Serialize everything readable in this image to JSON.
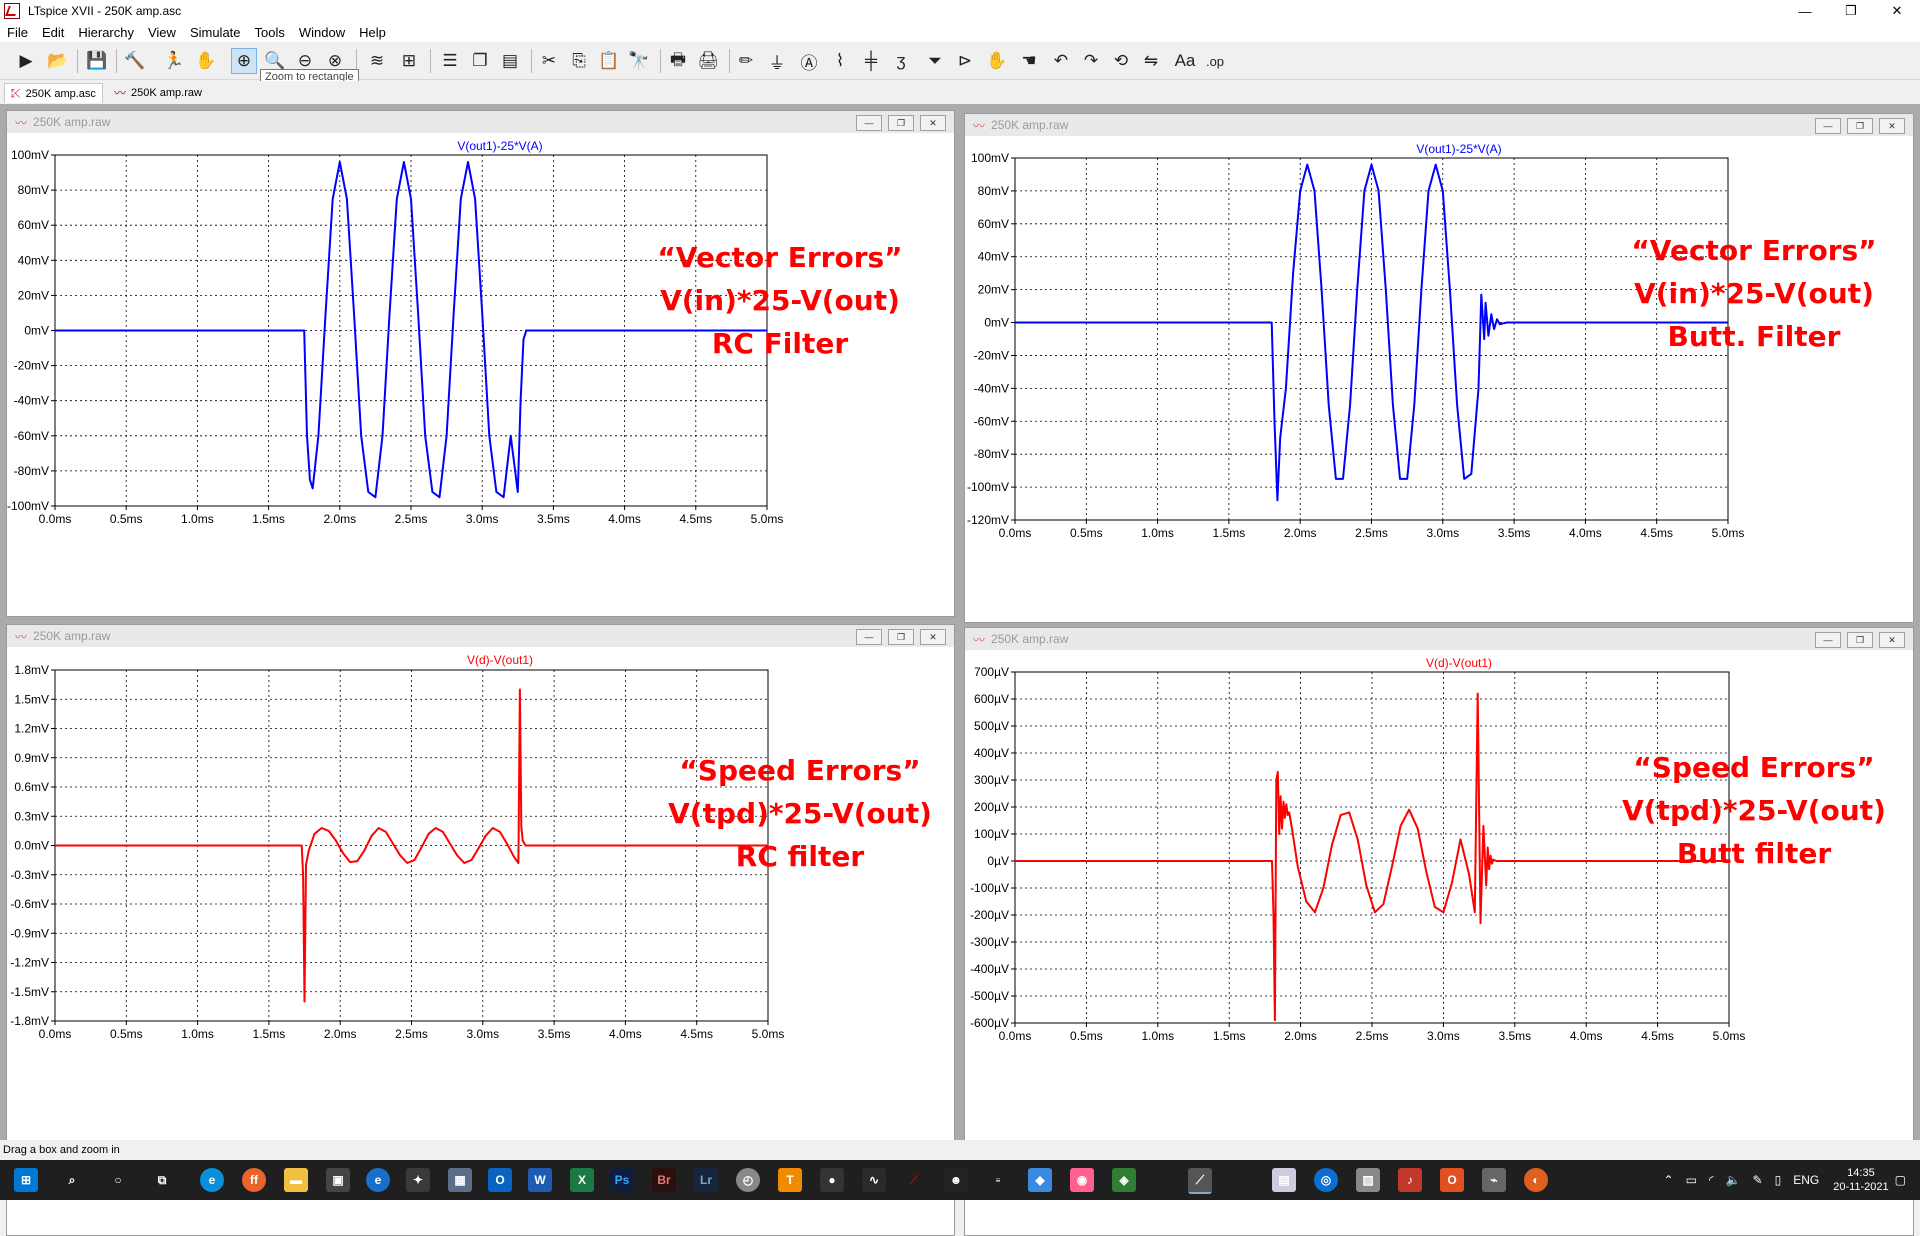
{
  "window": {
    "title": "LTspice XVII - 250K amp.asc",
    "minimize": "—",
    "maximize": "❐",
    "close": "✕"
  },
  "menu": [
    "File",
    "Edit",
    "Hierarchy",
    "View",
    "Simulate",
    "Tools",
    "Window",
    "Help"
  ],
  "tooltip": "Zoom to rectangle",
  "doc_tabs": [
    {
      "label": "250K amp.asc"
    },
    {
      "label": "250K amp.raw"
    }
  ],
  "status": "Drag a box and zoom in",
  "panes": [
    {
      "window_title": "250K amp.raw",
      "trace": "V(out1)-25*V(A)",
      "color": "#0000ff",
      "annotation": [
        "“Vector Errors”",
        "V(in)*25-V(out)",
        "RC Filter"
      ]
    },
    {
      "window_title": "250K amp.raw",
      "trace": "V(out1)-25*V(A)",
      "color": "#0000ff",
      "annotation": [
        "“Vector Errors”",
        "V(in)*25-V(out)",
        "Butt. Filter"
      ]
    },
    {
      "window_title": "250K amp.raw",
      "trace": "V(d)-V(out1)",
      "color": "#ff0000",
      "annotation": [
        "“Speed Errors”",
        "V(tpd)*25-V(out)",
        "RC filter"
      ]
    },
    {
      "window_title": "250K amp.raw",
      "trace": "V(d)-V(out1)",
      "color": "#ff0000",
      "annotation": [
        "“Speed Errors”",
        "V(tpd)*25-V(out)",
        "Butt filter"
      ]
    }
  ],
  "chart_data": [
    {
      "type": "line",
      "title": "V(out1)-25*V(A)",
      "xlim": [
        0,
        5
      ],
      "ylim": [
        -100,
        100
      ],
      "x_ticks": [
        "0.0ms",
        "0.5ms",
        "1.0ms",
        "1.5ms",
        "2.0ms",
        "2.5ms",
        "3.0ms",
        "3.5ms",
        "4.0ms",
        "4.5ms",
        "5.0ms"
      ],
      "y_ticks": [
        "100mV",
        "80mV",
        "60mV",
        "40mV",
        "20mV",
        "0mV",
        "-20mV",
        "-40mV",
        "-60mV",
        "-80mV",
        "-100mV"
      ],
      "series": [
        {
          "name": "V(out1)-25*V(A)",
          "x": [
            0,
            1.75,
            1.77,
            1.79,
            1.81,
            1.85,
            1.9,
            1.95,
            2.0,
            2.05,
            2.1,
            2.15,
            2.2,
            2.25,
            2.3,
            2.35,
            2.4,
            2.45,
            2.5,
            2.55,
            2.6,
            2.65,
            2.7,
            2.75,
            2.8,
            2.85,
            2.9,
            2.95,
            3.0,
            3.05,
            3.1,
            3.15,
            3.2,
            3.25,
            3.27,
            3.29,
            3.31,
            3.35,
            5.0
          ],
          "y": [
            0,
            0,
            -60,
            -85,
            -90,
            -60,
            10,
            75,
            96,
            75,
            10,
            -60,
            -92,
            -95,
            -60,
            10,
            75,
            96,
            75,
            10,
            -60,
            -92,
            -95,
            -60,
            10,
            75,
            96,
            75,
            10,
            -60,
            -92,
            -95,
            -60,
            -92,
            -40,
            -5,
            0,
            0,
            0
          ]
        }
      ]
    },
    {
      "type": "line",
      "title": "V(out1)-25*V(A)",
      "xlim": [
        0,
        5
      ],
      "ylim": [
        -120,
        100
      ],
      "x_ticks": [
        "0.0ms",
        "0.5ms",
        "1.0ms",
        "1.5ms",
        "2.0ms",
        "2.5ms",
        "3.0ms",
        "3.5ms",
        "4.0ms",
        "4.5ms",
        "5.0ms"
      ],
      "y_ticks": [
        "100mV",
        "80mV",
        "60mV",
        "40mV",
        "20mV",
        "0mV",
        "-20mV",
        "-40mV",
        "-60mV",
        "-80mV",
        "-100mV",
        "-120mV"
      ],
      "series": [
        {
          "name": "V(out1)-25*V(A)",
          "x": [
            0,
            1.8,
            1.82,
            1.84,
            1.86,
            1.9,
            1.95,
            2.0,
            2.05,
            2.1,
            2.15,
            2.2,
            2.25,
            2.3,
            2.35,
            2.4,
            2.45,
            2.5,
            2.55,
            2.6,
            2.65,
            2.7,
            2.75,
            2.8,
            2.85,
            2.9,
            2.95,
            3.0,
            3.05,
            3.1,
            3.15,
            3.2,
            3.25,
            3.27,
            3.29,
            3.3,
            3.32,
            3.34,
            3.36,
            3.38,
            3.4,
            3.45,
            3.5,
            5.0
          ],
          "y": [
            0,
            0,
            -60,
            -108,
            -70,
            -40,
            30,
            80,
            96,
            80,
            20,
            -50,
            -95,
            -95,
            -50,
            20,
            80,
            96,
            80,
            20,
            -50,
            -95,
            -95,
            -50,
            20,
            80,
            96,
            80,
            20,
            -50,
            -95,
            -92,
            -40,
            17,
            -10,
            12,
            -8,
            5,
            -4,
            2,
            -1,
            0,
            0,
            0
          ]
        }
      ]
    },
    {
      "type": "line",
      "title": "V(d)-V(out1)",
      "xlim": [
        0,
        5
      ],
      "ylim": [
        -1.8,
        1.8
      ],
      "x_ticks": [
        "0.0ms",
        "0.5ms",
        "1.0ms",
        "1.5ms",
        "2.0ms",
        "2.5ms",
        "3.0ms",
        "3.5ms",
        "4.0ms",
        "4.5ms",
        "5.0ms"
      ],
      "y_ticks": [
        "1.8mV",
        "1.5mV",
        "1.2mV",
        "0.9mV",
        "0.6mV",
        "0.3mV",
        "0.0mV",
        "-0.3mV",
        "-0.6mV",
        "-0.9mV",
        "-1.2mV",
        "-1.5mV",
        "-1.8mV"
      ],
      "series": [
        {
          "name": "V(d)-V(out1)",
          "x": [
            0,
            1.73,
            1.74,
            1.75,
            1.76,
            1.78,
            1.82,
            1.87,
            1.92,
            1.97,
            2.02,
            2.07,
            2.12,
            2.17,
            2.22,
            2.27,
            2.32,
            2.37,
            2.42,
            2.47,
            2.52,
            2.57,
            2.62,
            2.67,
            2.72,
            2.77,
            2.82,
            2.87,
            2.92,
            2.97,
            3.02,
            3.07,
            3.12,
            3.17,
            3.22,
            3.25,
            3.26,
            3.27,
            3.28,
            3.3,
            5.0
          ],
          "y": [
            0,
            0,
            -0.3,
            -1.6,
            -0.2,
            -0.05,
            0.12,
            0.18,
            0.15,
            0.05,
            -0.08,
            -0.17,
            -0.16,
            -0.05,
            0.1,
            0.18,
            0.14,
            0.02,
            -0.1,
            -0.18,
            -0.15,
            -0.02,
            0.12,
            0.18,
            0.14,
            0.02,
            -0.1,
            -0.18,
            -0.15,
            -0.03,
            0.1,
            0.18,
            0.14,
            0.02,
            -0.12,
            -0.18,
            1.6,
            0.2,
            0.05,
            0,
            0
          ]
        }
      ]
    },
    {
      "type": "line",
      "title": "V(d)-V(out1)",
      "xlim": [
        0,
        5
      ],
      "ylim": [
        -600,
        700
      ],
      "x_ticks": [
        "0.0ms",
        "0.5ms",
        "1.0ms",
        "1.5ms",
        "2.0ms",
        "2.5ms",
        "3.0ms",
        "3.5ms",
        "4.0ms",
        "4.5ms",
        "5.0ms"
      ],
      "y_ticks": [
        "700µV",
        "600µV",
        "500µV",
        "400µV",
        "300µV",
        "200µV",
        "100µV",
        "0µV",
        "-100µV",
        "-200µV",
        "-300µV",
        "-400µV",
        "-500µV",
        "-600µV"
      ],
      "series": [
        {
          "name": "V(d)-V(out1)",
          "x": [
            0,
            1.8,
            1.81,
            1.82,
            1.83,
            1.84,
            1.85,
            1.86,
            1.87,
            1.88,
            1.89,
            1.9,
            1.91,
            1.92,
            1.94,
            1.98,
            2.04,
            2.1,
            2.16,
            2.22,
            2.28,
            2.34,
            2.4,
            2.46,
            2.52,
            2.58,
            2.64,
            2.7,
            2.76,
            2.82,
            2.88,
            2.94,
            3.0,
            3.06,
            3.12,
            3.18,
            3.22,
            3.24,
            3.26,
            3.28,
            3.3,
            3.31,
            3.32,
            3.33,
            3.34,
            3.35,
            3.37,
            3.4,
            3.45,
            5.0
          ],
          "y": [
            0,
            0,
            -200,
            -590,
            300,
            330,
            100,
            240,
            120,
            220,
            160,
            210,
            170,
            180,
            120,
            -20,
            -150,
            -190,
            -100,
            60,
            170,
            180,
            80,
            -90,
            -190,
            -160,
            -20,
            130,
            190,
            120,
            -40,
            -170,
            -190,
            -80,
            80,
            -50,
            -190,
            620,
            -230,
            130,
            -90,
            50,
            -30,
            20,
            -10,
            5,
            0,
            0,
            0,
            0
          ]
        }
      ]
    }
  ]
}
